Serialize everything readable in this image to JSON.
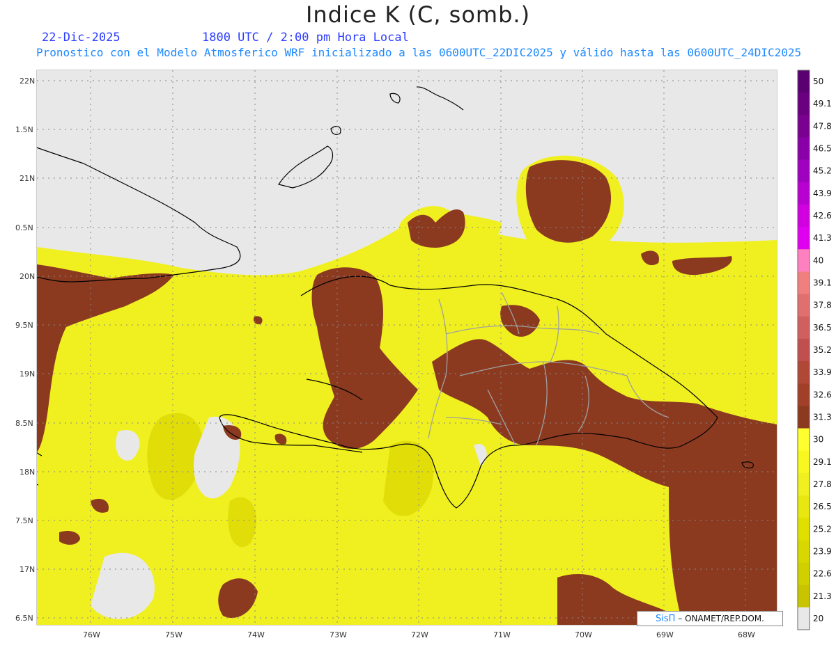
{
  "header": {
    "title": "Indice K (C, somb.)",
    "date": "22-Dic-2025",
    "time": "1800 UTC / 2:00 pm Hora Local",
    "description": "Pronostico con el Modelo Atmosferico WRF inicializado a las 0600UTC_22DIC2025 y válido hasta las  0600UTC_24DIC2025"
  },
  "map": {
    "lat_labels": [
      "22N",
      "1.5N",
      "21N",
      "0.5N",
      "20N",
      "9.5N",
      "19N",
      "8.5N",
      "18N",
      "7.5N",
      "17N",
      "6.5N"
    ],
    "lon_labels": [
      "76W",
      "75W",
      "74W",
      "73W",
      "72W",
      "71W",
      "70W",
      "69W",
      "68W"
    ],
    "colors": {
      "background": "#e8e8e8",
      "yellow_low": "#c8c400",
      "yellow": "#f0f020",
      "yellow_bright": "#ffff30",
      "brown_dark": "#8b3a20",
      "brown": "#a04a3a",
      "brown_light": "#b05a50",
      "coast": "#000000",
      "borders": "#a0a0a0"
    }
  },
  "colorbar": {
    "labels": [
      "50",
      "49.1",
      "47.8",
      "46.5",
      "45.2",
      "43.9",
      "42.6",
      "41.3",
      "40",
      "39.1",
      "37.8",
      "36.5",
      "35.2",
      "33.9",
      "32.6",
      "31.3",
      "30",
      "29.1",
      "27.8",
      "26.5",
      "25.2",
      "23.9",
      "22.6",
      "21.3",
      "20"
    ],
    "colors": [
      "#5a0070",
      "#6a0080",
      "#7a0090",
      "#8a00a8",
      "#a000c0",
      "#b800d0",
      "#d000e0",
      "#e000f0",
      "#ff80c0",
      "#f08080",
      "#e07070",
      "#d06060",
      "#c05050",
      "#b04838",
      "#a04028",
      "#8b3a20",
      "#ffff30",
      "#f8f820",
      "#f0f020",
      "#e8e810",
      "#e0e000",
      "#d8d800",
      "#d0d000",
      "#c8c400",
      "#e8e8e8"
    ]
  },
  "credit": {
    "logo": "SisΠ",
    "text": "– ONAMET/REP.DOM."
  }
}
